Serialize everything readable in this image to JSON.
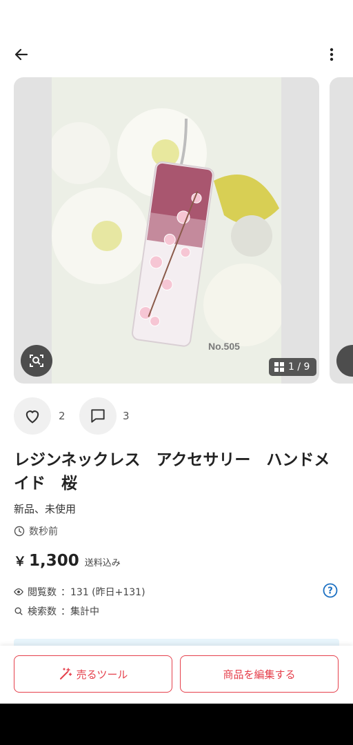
{
  "header": {
    "back_icon": "arrow-left-icon",
    "more_icon": "more-vertical-icon"
  },
  "gallery": {
    "counter": "1 / 9",
    "watermark": "No.505",
    "zoom_icon": "image-search-icon",
    "counter_icon": "grid-icon"
  },
  "reactions": {
    "likes_count": "2",
    "comments_count": "3",
    "like_icon": "heart-icon",
    "comment_icon": "comment-icon"
  },
  "item": {
    "title": "レジンネックレス　アクセサリー　ハンドメイド　桜",
    "condition": "新品、未使用",
    "posted": "数秒前",
    "price_symbol": "￥",
    "price": "1,300",
    "shipping_note": "送料込み"
  },
  "stats": {
    "views_label": "閲覧数",
    "views_value": "：131 (昨日+131)",
    "searches_label": "検索数",
    "searches_value": "：集計中"
  },
  "actions": {
    "sell_tools_label": "売るツール",
    "edit_label": "商品を編集する"
  },
  "colors": {
    "accent": "#e53f4b",
    "help": "#1a6fc2"
  }
}
